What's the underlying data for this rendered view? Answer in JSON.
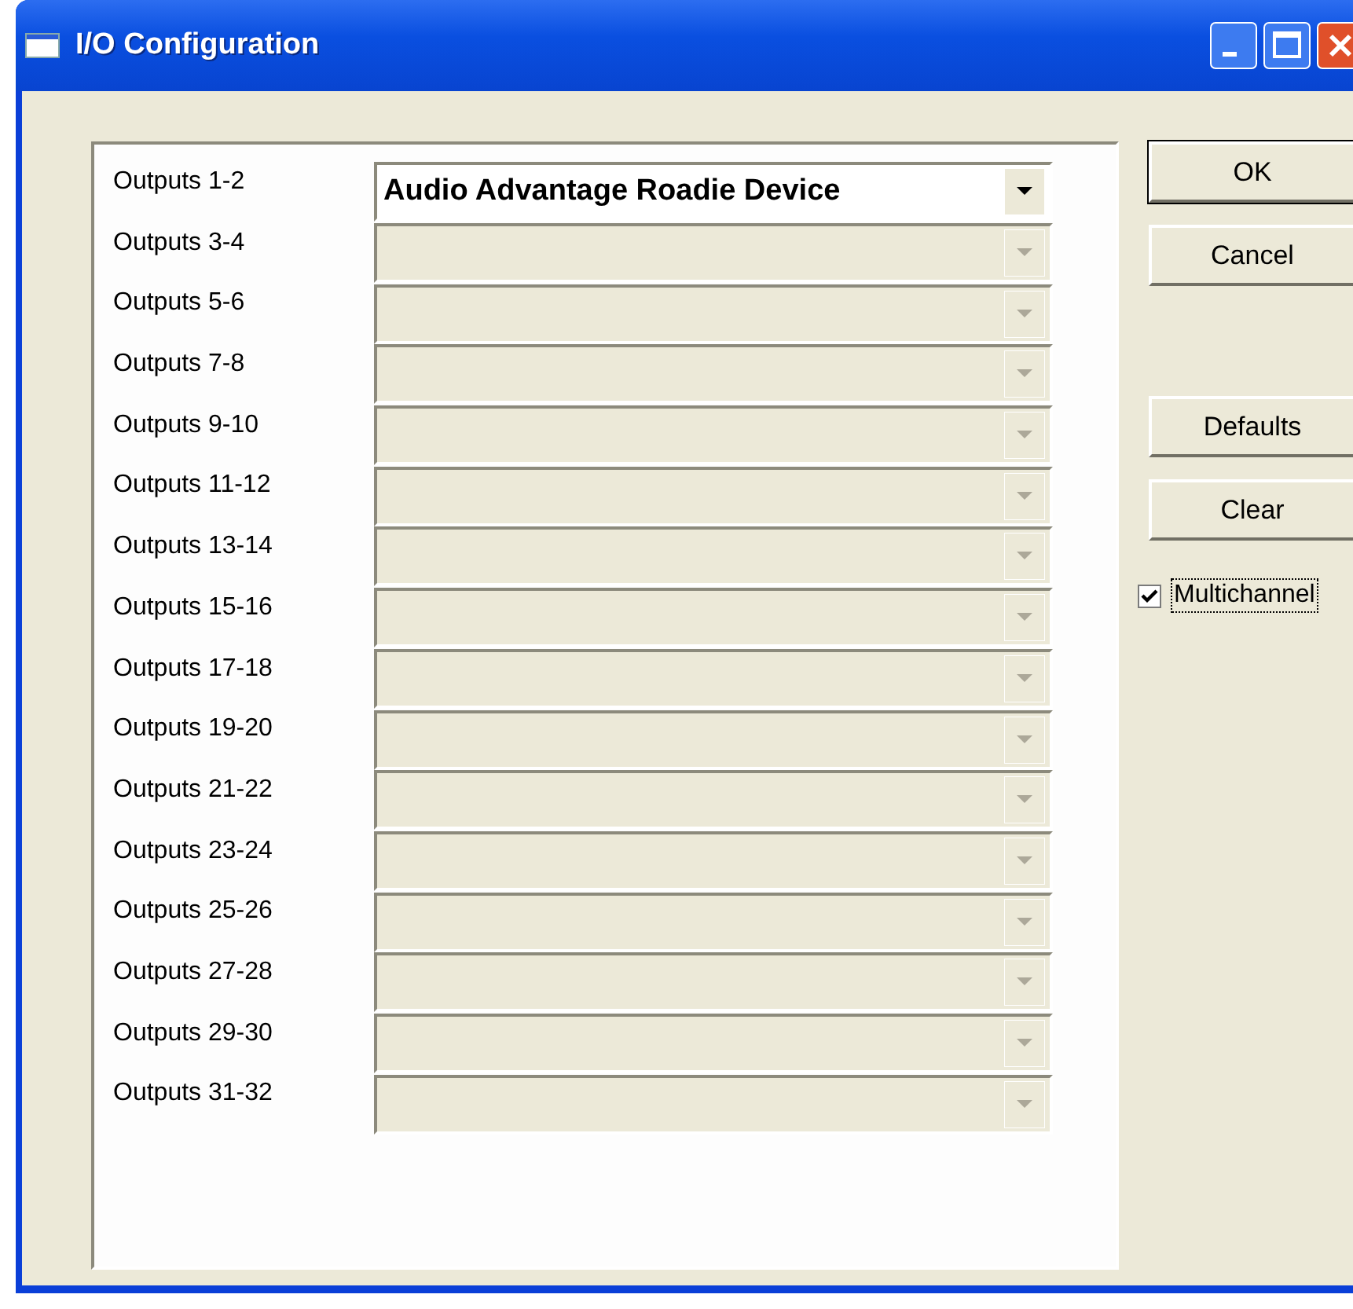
{
  "window": {
    "title": "I/O Configuration"
  },
  "outputs": [
    {
      "label": "Outputs 1-2",
      "value": "Audio Advantage Roadie Device",
      "disabled": false
    },
    {
      "label": "Outputs 3-4",
      "disabled": true
    },
    {
      "label": "Outputs 5-6",
      "disabled": true
    },
    {
      "label": "Outputs 7-8",
      "disabled": true
    },
    {
      "label": "Outputs 9-10",
      "disabled": true
    },
    {
      "label": "Outputs 11-12",
      "disabled": true
    },
    {
      "label": "Outputs 13-14",
      "disabled": true
    },
    {
      "label": "Outputs 15-16",
      "disabled": true
    },
    {
      "label": "Outputs 17-18",
      "disabled": true
    },
    {
      "label": "Outputs 19-20",
      "disabled": true
    },
    {
      "label": "Outputs 21-22",
      "disabled": true
    },
    {
      "label": "Outputs 23-24",
      "disabled": true
    },
    {
      "label": "Outputs 25-26",
      "disabled": true
    },
    {
      "label": "Outputs 27-28",
      "disabled": true
    },
    {
      "label": "Outputs 29-30",
      "disabled": true
    },
    {
      "label": "Outputs 31-32",
      "disabled": true
    }
  ],
  "buttons_top": [
    {
      "label": "OK",
      "default": true
    },
    {
      "label": "Cancel",
      "default": false
    }
  ],
  "buttons_bottom": [
    {
      "label": "Defaults"
    },
    {
      "label": "Clear"
    }
  ],
  "multichannel": {
    "label": "Multichannel",
    "checked": true
  }
}
